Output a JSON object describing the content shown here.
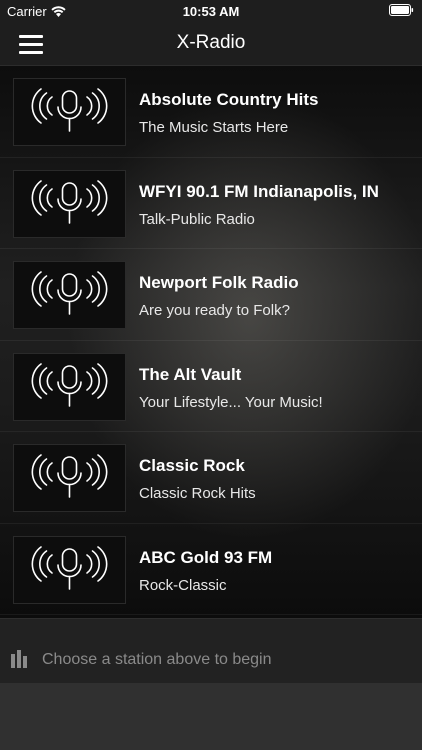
{
  "status_bar": {
    "carrier": "Carrier",
    "time": "10:53 AM",
    "wifi_icon": "wifi-icon",
    "battery_icon": "battery-icon"
  },
  "nav": {
    "title": "X-Radio",
    "menu_icon": "hamburger-menu-icon"
  },
  "stations": [
    {
      "name": "Absolute Country Hits",
      "desc": "The Music Starts Here"
    },
    {
      "name": "WFYI 90.1 FM Indianapolis, IN",
      "desc": "Talk-Public Radio"
    },
    {
      "name": "Newport Folk Radio",
      "desc": "Are you ready to Folk?"
    },
    {
      "name": "The Alt Vault",
      "desc": "Your Lifestyle... Your Music!"
    },
    {
      "name": "Classic Rock",
      "desc": "Classic Rock Hits"
    },
    {
      "name": "ABC Gold 93 FM",
      "desc": "Rock-Classic"
    }
  ],
  "player": {
    "status_text": "Choose a station above to begin",
    "icon": "equalizer-icon"
  },
  "colors": {
    "bar_bg": "#1e1e1e",
    "player_bg": "#222222",
    "muted_text": "#8a8a8a"
  }
}
